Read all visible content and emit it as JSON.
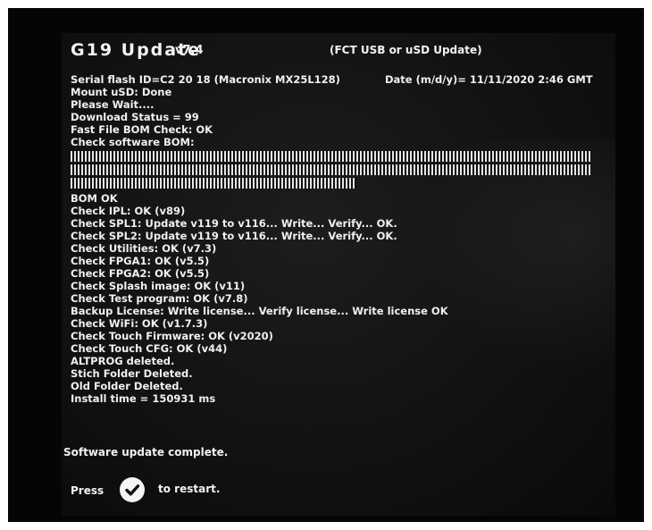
{
  "header": {
    "title": "G19 Update",
    "version": "v7.4",
    "mode": "(FCT USB or uSD Update)"
  },
  "serial_flash": "Serial flash ID=C2 20 18 (Macronix MX25L128)",
  "date": "Date (m/d/y)= 11/11/2020  2:46 GMT",
  "log_lines_before_bars": [
    "Mount uSD: Done",
    "Please Wait....",
    "Download Status = 99",
    "Fast File BOM Check: OK",
    "Check software BOM:"
  ],
  "bom_progress": [
    1.0,
    1.0,
    0.55
  ],
  "log_lines_after_bars": [
    "BOM OK",
    "Check IPL: OK (v89)",
    "Check SPL1: Update v119 to v116... Write...  Verify...  OK.",
    "Check SPL2: Update v119 to v116... Write...  Verify...  OK.",
    "Check Utilities: OK (v7.3)",
    "Check FPGA1: OK (v5.5)",
    "Check FPGA2: OK (v5.5)",
    "Check Splash image: OK (v11)",
    "Check Test program: OK (v7.8)",
    "Backup License:  Write license...  Verify license...  Write license OK",
    "Check WiFi: OK (v1.7.3)",
    "Check Touch Firmware: OK (v2020)",
    "Check Touch CFG: OK (v44)",
    "ALTPROG deleted.",
    "Stich Folder Deleted.",
    "Old Folder Deleted.",
    "Install time = 150931 ms"
  ],
  "status": "Software update complete.",
  "prompt": {
    "press": "Press",
    "icon": "checkmark-circle-icon",
    "restart": "to restart."
  }
}
